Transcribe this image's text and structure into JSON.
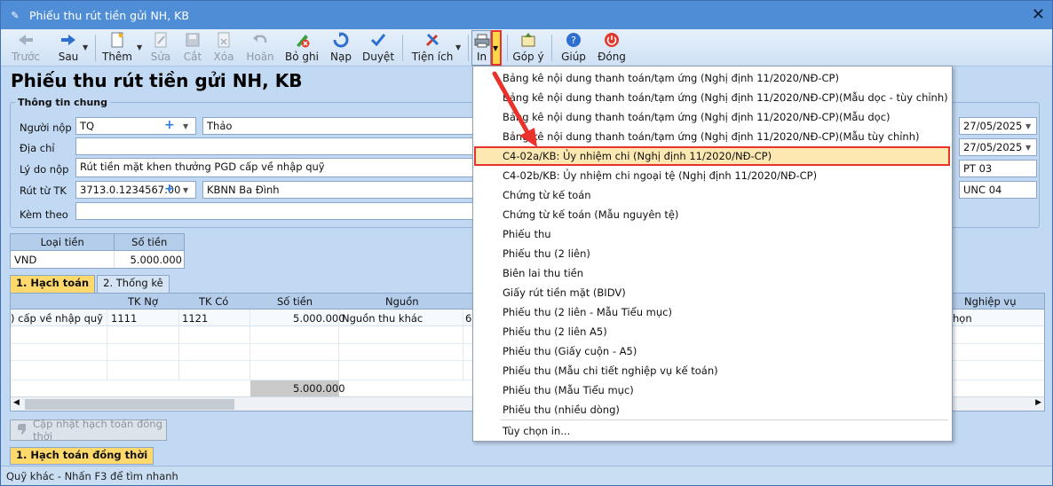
{
  "window": {
    "title": "Phiếu thu rút tiền gửi NH, KB",
    "close_glyph": "✕"
  },
  "toolbar": {
    "back": "Trước",
    "next": "Sau",
    "add": "Thêm",
    "edit": "Sửa",
    "cut": "Cắt",
    "delete": "Xóa",
    "undo": "Hoãn",
    "unrecord": "Bỏ ghi",
    "reload": "Nạp",
    "approve": "Duyệt",
    "utilities": "Tiện ích",
    "print": "In",
    "feedback": "Góp ý",
    "help": "Giúp",
    "close": "Đóng"
  },
  "page_title": "Phiếu thu rút tiền gửi NH, KB",
  "general": {
    "group_label": "Thông tin chung",
    "payer_label": "Người nộp",
    "payer_code": "TQ",
    "payer_name": "Thảo",
    "address_label": "Địa chỉ",
    "address": "",
    "reason_label": "Lý do nộp",
    "reason": "Rút tiền mặt khen thưởng PGD cấp về nhập quỹ",
    "account_label": "Rút từ TK",
    "account_no": "3713.0.1234567.00",
    "account_bank": "KBNN Ba Đình",
    "attach_label": "Kèm theo",
    "attach": ""
  },
  "right_fields": {
    "date1": "27/05/2025",
    "date2": "27/05/2025",
    "voucher_no": "PT  03",
    "unc_no": "UNC  04"
  },
  "currency_table": {
    "headers": [
      "Loại tiền",
      "Số tiền"
    ],
    "row": [
      "VND",
      "5.000.000"
    ]
  },
  "tabs": [
    "1. Hạch toán",
    "2. Thống kê"
  ],
  "grid": {
    "headers": [
      "TK Nợ",
      "TK Có",
      "Số tiền",
      "Nguồn",
      "Nghiệp vụ"
    ],
    "row1": {
      "desc": ") cấp về nhập quỹ",
      "debit": "1111",
      "credit": "1121",
      "amount": "5.000.000",
      "source": "Nguồn thu  khác",
      "extra": "6",
      "biz": "họn"
    },
    "total": "5.000.000"
  },
  "update_button": "Cập nhật hạch toán đồng thời",
  "tab_bottom": "1. Hạch toán đồng thời",
  "status": "Quỹ khác - Nhấn F3 để tìm nhanh",
  "print_menu": {
    "items": [
      "Bảng kê nội dung thanh toán/tạm ứng (Nghị định 11/2020/NĐ-CP)",
      "Bảng kê nội dung thanh toán/tạm ứng (Nghị định 11/2020/NĐ-CP)(Mẫu dọc - tùy chỉnh)",
      "Bảng kê nội dung thanh toán/tạm ứng (Nghị định 11/2020/NĐ-CP)(Mẫu dọc)",
      "Bảng kê nội dung thanh toán/tạm ứng (Nghị định 11/2020/NĐ-CP)(Mẫu tùy chỉnh)",
      "C4-02a/KB: Ủy nhiệm chi (Nghị định 11/2020/NĐ-CP)",
      "C4-02b/KB: Ủy nhiệm chi ngoại tệ (Nghị định 11/2020/NĐ-CP)",
      "Chứng từ kế toán",
      "Chứng từ kế toán (Mẫu nguyên tệ)",
      "Phiếu thu",
      "Phiếu thu (2 liên)",
      "Biên lai thu tiền",
      "Giấy rút tiền mặt (BIDV)",
      "Phiếu thu (2 liên - Mẫu Tiểu mục)",
      "Phiếu thu (2 liên A5)",
      "Phiếu thu (Giấy cuộn - A5)",
      "Phiếu thu (Mẫu chi tiết nghiệp vụ kế toán)",
      "Phiếu thu (Mẫu Tiểu mục)",
      "Phiếu thu (nhiều dòng)"
    ],
    "options": "Tùy chọn in..."
  },
  "colors": {
    "highlight_border": "#e8322a",
    "highlight_fill": "#fde8b2",
    "title_bar": "#4f8ed6"
  }
}
